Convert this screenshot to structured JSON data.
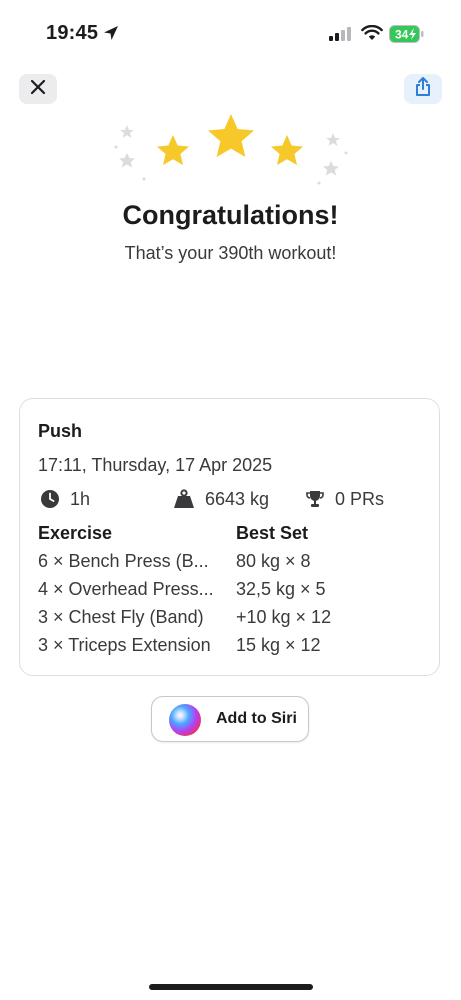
{
  "status_bar": {
    "time": "19:45",
    "battery": "34"
  },
  "header": {
    "close_icon": "close-icon",
    "share_icon": "share-icon"
  },
  "celebration": {
    "title": "Congratulations!",
    "subtitle": "That’s your 390th workout!"
  },
  "workout": {
    "name": "Push",
    "datetime": "17:11, Thursday, 17 Apr 2025",
    "duration": "1h",
    "volume": "6643 kg",
    "prs": "0 PRs",
    "columns": {
      "exercise": "Exercise",
      "best_set": "Best Set"
    },
    "exercises": [
      {
        "name": "6 × Bench Press (B...",
        "best_set": "80 kg × 8"
      },
      {
        "name": "4 × Overhead Press...",
        "best_set": "32,5 kg × 5"
      },
      {
        "name": "3 × Chest Fly (Band)",
        "best_set": "+10 kg × 12"
      },
      {
        "name": "3 × Triceps Extension",
        "best_set": "15 kg × 12"
      }
    ]
  },
  "siri": {
    "label": "Add to Siri"
  },
  "colors": {
    "star": "#f7c829",
    "faint_star": "#dcdcdf",
    "share_accent": "#2f7fd6",
    "battery_green": "#34c759"
  }
}
